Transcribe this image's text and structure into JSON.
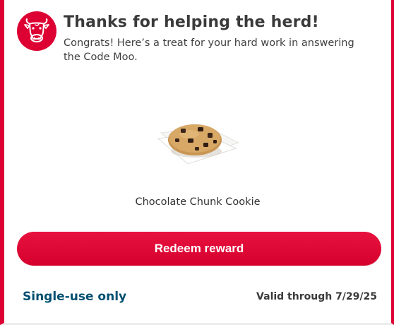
{
  "modal": {
    "title": "Thanks for helping the herd!",
    "message": "Congrats! Here’s a treat for your hard work in answering the Code Moo.",
    "badge_icon": "cow-head-icon",
    "reward": {
      "image_icon": "cookie-image",
      "name": "Chocolate Chunk Cookie"
    },
    "redeem_button_label": "Redeem reward",
    "usage_note": "Single-use only",
    "validity": "Valid through 7/29/25"
  },
  "colors": {
    "brand_red": "#dd0033",
    "navy": "#004f71",
    "text_dark": "#3a3a3a"
  }
}
